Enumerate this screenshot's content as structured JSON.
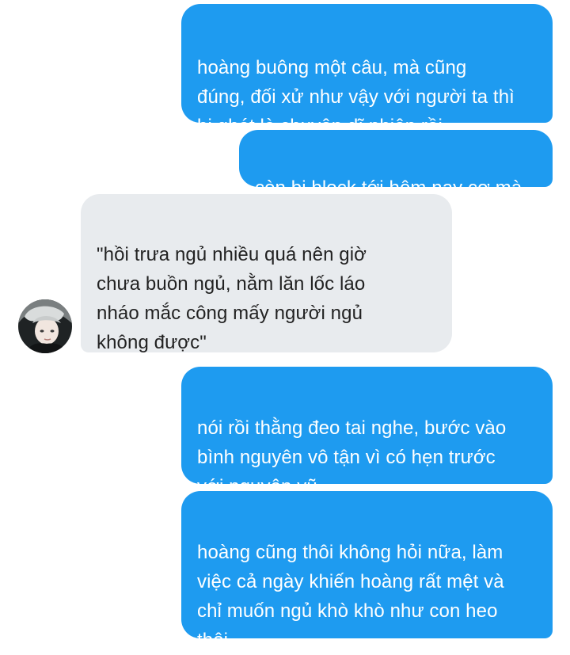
{
  "conversation": {
    "messages": [
      {
        "direction": "outgoing",
        "text": "hoàng buông một câu, mà cũng\nđúng, đối xử như vậy với người ta thì\nbị ghét là chuyện dĩ nhiên rồi"
      },
      {
        "direction": "outgoing",
        "text": "còn bị block tới hôm nay cơ mà"
      },
      {
        "direction": "incoming",
        "text": "\"hồi trưa ngủ nhiều quá nên giờ\nchưa buồn ngủ, nằm lăn lốc láo\nnháo mắc công mấy người ngủ\nkhông được\""
      },
      {
        "direction": "outgoing",
        "text": "nói rồi thằng đeo tai nghe, bước vào\nbình nguyên vô tận vì có hẹn trước\nvới nguyên vũ"
      },
      {
        "direction": "outgoing",
        "text": "hoàng cũng thôi không hỏi nữa, làm\nviệc cả ngày khiến hoàng rất mệt và\nchỉ muốn ngủ khò khò như con heo\nthôi"
      }
    ]
  },
  "colors": {
    "outgoing_bubble": "#1e9bf0",
    "incoming_bubble": "#e8ebee"
  },
  "icons": {
    "avatar": "user-avatar-photo"
  }
}
